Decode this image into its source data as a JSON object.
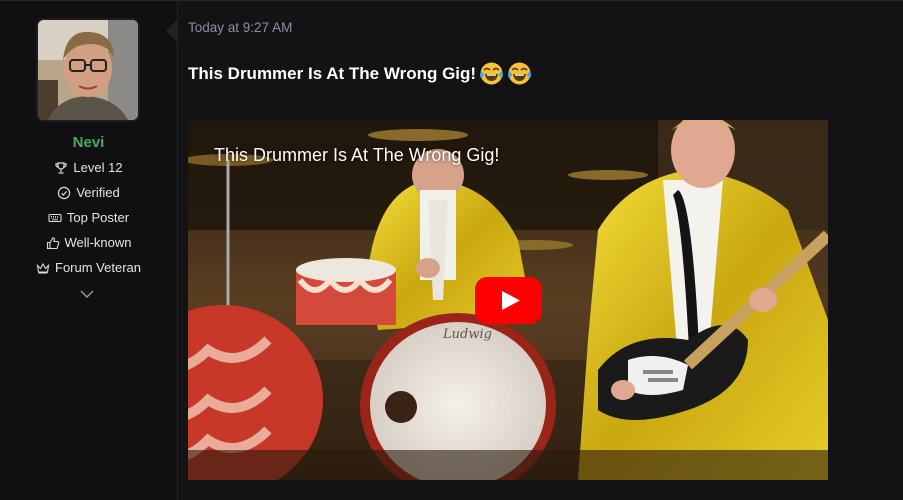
{
  "user": {
    "name": "Nevi",
    "avatar_icon": "user-avatar-photo",
    "name_color": "#4fa860",
    "badges": [
      {
        "label": "Level 12",
        "icon": "trophy-icon"
      },
      {
        "label": "Verified",
        "icon": "check-circle-icon"
      },
      {
        "label": "Top Poster",
        "icon": "keyboard-icon"
      },
      {
        "label": "Well-known",
        "icon": "thumbs-up-icon"
      },
      {
        "label": "Forum Veteran",
        "icon": "crown-icon"
      }
    ],
    "expand_icon": "chevron-down-icon"
  },
  "post": {
    "timestamp": "Today at 9:27 AM",
    "title": "This Drummer Is At The Wrong Gig!",
    "title_emojis": [
      "face-with-tears-of-joy-emoji",
      "face-with-tears-of-joy-emoji"
    ],
    "video": {
      "title": "This Drummer Is At The Wrong Gig!",
      "play_icon": "youtube-play-icon",
      "play_color": "#ff0000"
    }
  }
}
